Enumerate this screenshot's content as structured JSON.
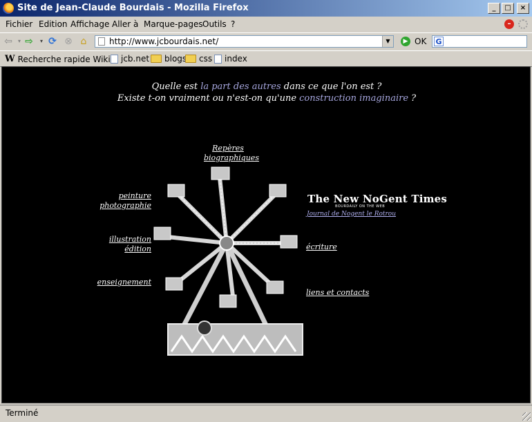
{
  "window": {
    "title": "Site de Jean-Claude Bourdais - Mozilla Firefox"
  },
  "menu": [
    {
      "label": "Fichier"
    },
    {
      "label": "Edition"
    },
    {
      "label": "Affichage"
    },
    {
      "label": "Aller à"
    },
    {
      "label": "Marque-pages"
    },
    {
      "label": "Outils"
    },
    {
      "label": "?"
    }
  ],
  "nav": {
    "url": "http://www.jcbourdais.net/",
    "go_label": "OK",
    "search_engine_icon": "G"
  },
  "bookmarks": [
    {
      "label": "Recherche rapide Wiki...",
      "icon": "wikipedia-icon"
    },
    {
      "label": "jcb.net",
      "icon": "page-icon"
    },
    {
      "label": "blogs",
      "icon": "folder-icon"
    },
    {
      "label": "css",
      "icon": "folder-icon"
    },
    {
      "label": "index",
      "icon": "page-icon"
    }
  ],
  "page": {
    "line1_a": "Quelle est ",
    "line1_hl": "la part des autres",
    "line1_b": " dans ce que l'on est ?",
    "line2_a": "Existe t-on vraiment ou n'est-on qu'une ",
    "line2_hl": "construction imaginaire",
    "line2_b": " ?",
    "links": {
      "reperes_1": "Repères",
      "reperes_2": "biographiques",
      "peinture": "peinture",
      "photographie": "photographie",
      "illustration": "illustration",
      "edition": "édition",
      "enseignement": "enseignement",
      "ecriture": "écriture",
      "liens": "liens et contacts"
    },
    "nyt": {
      "logo": "The New NoGent Times",
      "sub": "BOURDAILY ON THE WEB",
      "link": "Journal de Nogent le Rotrou"
    }
  },
  "status": {
    "text": "Terminé"
  },
  "colors": {
    "highlight": "#a8a8e0",
    "content_bg": "#000000",
    "titlebar": "#0a246a"
  }
}
